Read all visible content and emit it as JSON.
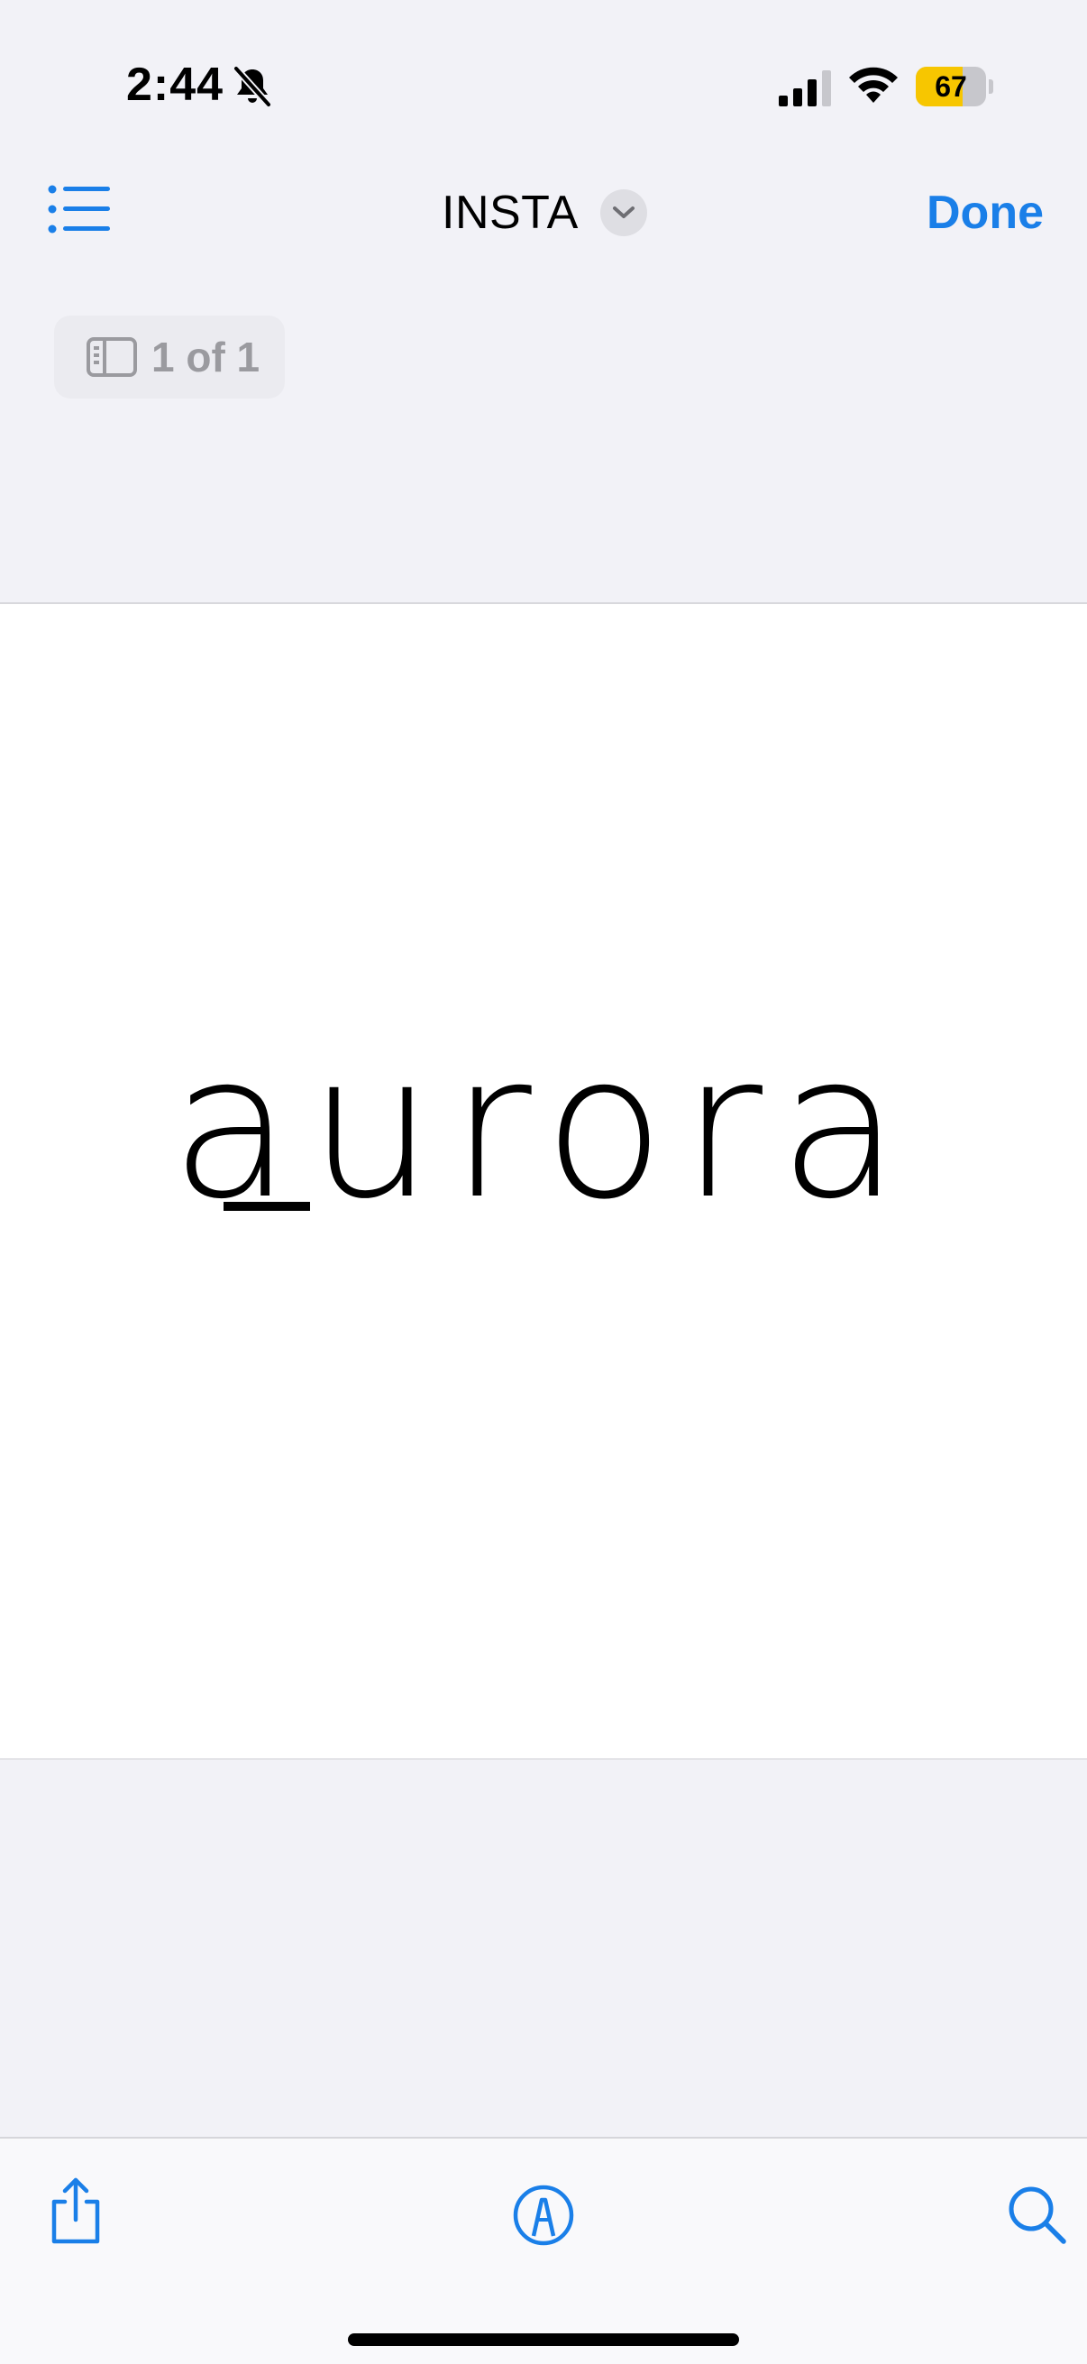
{
  "status_bar": {
    "time": "2:44",
    "battery_percent": "67",
    "icons": [
      "bell-slash-icon",
      "cellular-signal-icon",
      "wifi-icon",
      "battery-icon"
    ],
    "colors": {
      "battery_fill": "#f7c600"
    }
  },
  "nav": {
    "title": "INSTA",
    "done_label": "Done",
    "icons": [
      "list-icon",
      "chevron-down-icon"
    ],
    "accent_color": "#1a7fe8"
  },
  "page_indicator": {
    "label": "1 of 1",
    "icon": "sidebar-icon"
  },
  "document": {
    "logo_text": "aurora"
  },
  "toolbar": {
    "icons": [
      "share-icon",
      "markup-icon",
      "search-icon"
    ]
  }
}
